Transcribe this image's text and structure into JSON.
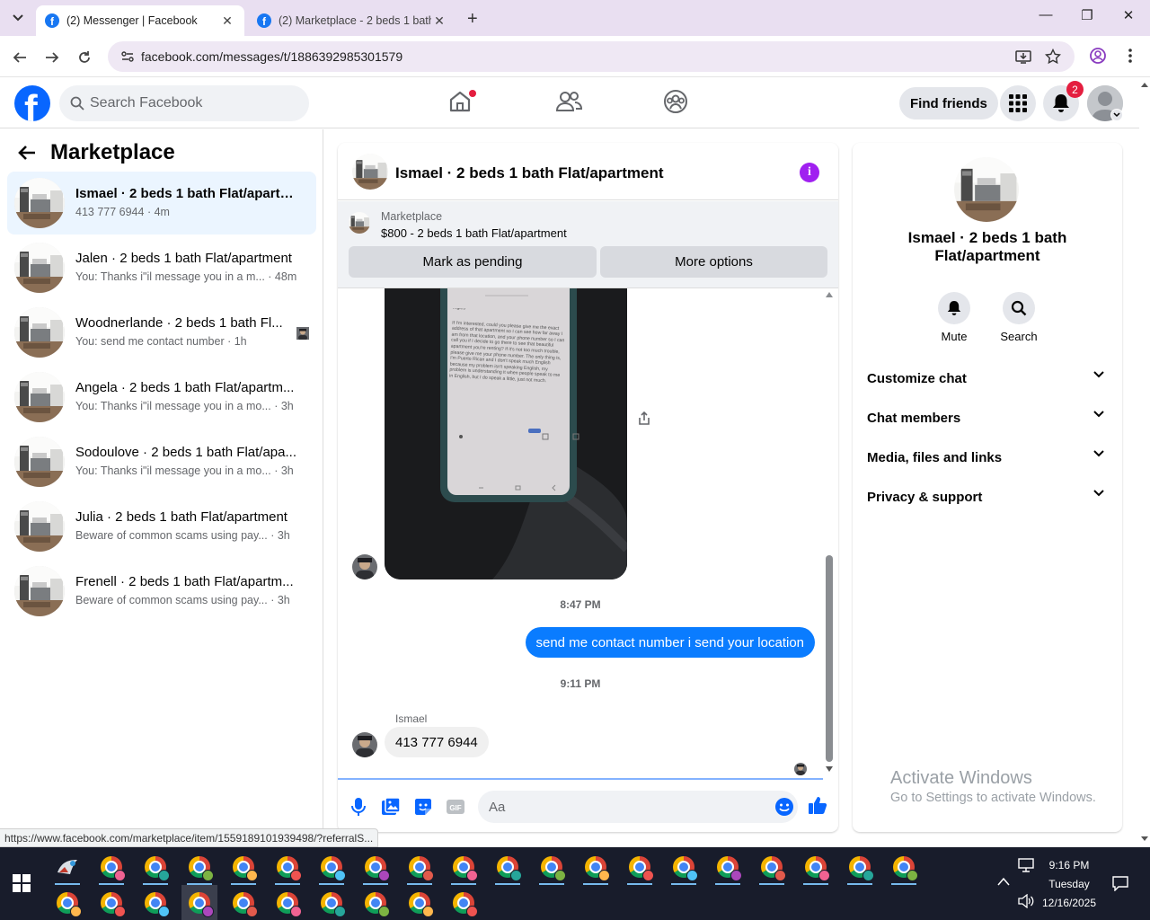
{
  "browser": {
    "tabs": [
      {
        "title": "(2) Messenger | Facebook",
        "active": true
      },
      {
        "title": "(2) Marketplace - 2 beds 1 bath",
        "active": false
      }
    ],
    "url": "facebook.com/messages/t/1886392985301579",
    "status_url": "https://www.facebook.com/marketplace/item/1559189101939498/?referralS..."
  },
  "fb": {
    "search_placeholder": "Search Facebook",
    "find_friends": "Find friends",
    "notification_count": "2"
  },
  "sidebar": {
    "title": "Marketplace",
    "conversations": [
      {
        "name": "Ismael · 2 beds 1 bath Flat/apartm...",
        "snippet": "413 777 6944",
        "time": "4m",
        "active": true,
        "seen_avatar": false
      },
      {
        "name": "Jalen · 2 beds 1 bath Flat/apartment",
        "snippet": "You: Thanks i\"il message you in a m...",
        "time": "48m",
        "active": false,
        "seen_avatar": false
      },
      {
        "name": "Woodnerlande · 2 beds 1 bath Fl...",
        "snippet": "You: send me contact number",
        "time": "1h",
        "active": false,
        "seen_avatar": true
      },
      {
        "name": "Angela · 2 beds 1 bath Flat/apartm...",
        "snippet": "You: Thanks i\"il message you in a mo...",
        "time": "3h",
        "active": false,
        "seen_avatar": false
      },
      {
        "name": "Sodoulove · 2 beds 1 bath Flat/apa...",
        "snippet": "You: Thanks i\"il message you in a mo...",
        "time": "3h",
        "active": false,
        "seen_avatar": false
      },
      {
        "name": "Julia · 2 beds 1 bath Flat/apartment",
        "snippet": "Beware of common scams using pay...",
        "time": "3h",
        "active": false,
        "seen_avatar": false
      },
      {
        "name": "Frenell · 2 beds 1 bath Flat/apartm...",
        "snippet": "Beware of common scams using pay...",
        "time": "3h",
        "active": false,
        "seen_avatar": false
      }
    ]
  },
  "chat": {
    "title": "Ismael · 2 beds 1 bath Flat/apartment",
    "marketplace_label": "Marketplace",
    "listing": "$800 - 2 beds 1 bath Flat/apartment",
    "mark_pending": "Mark as pending",
    "more_options": "More options",
    "photo_text": {
      "lang": "Inglés",
      "body": "If I'm interested, could you please give me the exact address of that apartment so I can see how far away I am from that location, and your phone number so I can call you if I decide to go there to see that beautiful apartment you're renting? If it's not too much trouble, please give me your phone number. The only thing is, I'm Puerto Rican and I don't speak much English because my problem isn't speaking English, my problem is understanding it when people speak to me in English, but I do speak a little, just not much."
    },
    "timestamp1": "8:47 PM",
    "outgoing_message": "send me contact number i send your location",
    "timestamp2": "9:11 PM",
    "sender_name": "Ismael",
    "incoming_message": "413 777 6944",
    "composer_placeholder": "Aa"
  },
  "details": {
    "name": "Ismael · 2 beds 1 bath Flat/apartment",
    "actions": [
      {
        "label": "Mute",
        "icon": "bell-icon"
      },
      {
        "label": "Search",
        "icon": "search-icon"
      }
    ],
    "sections": [
      "Customize chat",
      "Chat members",
      "Media, files and links",
      "Privacy & support"
    ]
  },
  "watermark": {
    "line1": "Activate Windows",
    "line2": "Go to Settings to activate Windows."
  },
  "taskbar": {
    "time": "9:16 PM",
    "day": "Tuesday",
    "date": "12/16/2025"
  }
}
